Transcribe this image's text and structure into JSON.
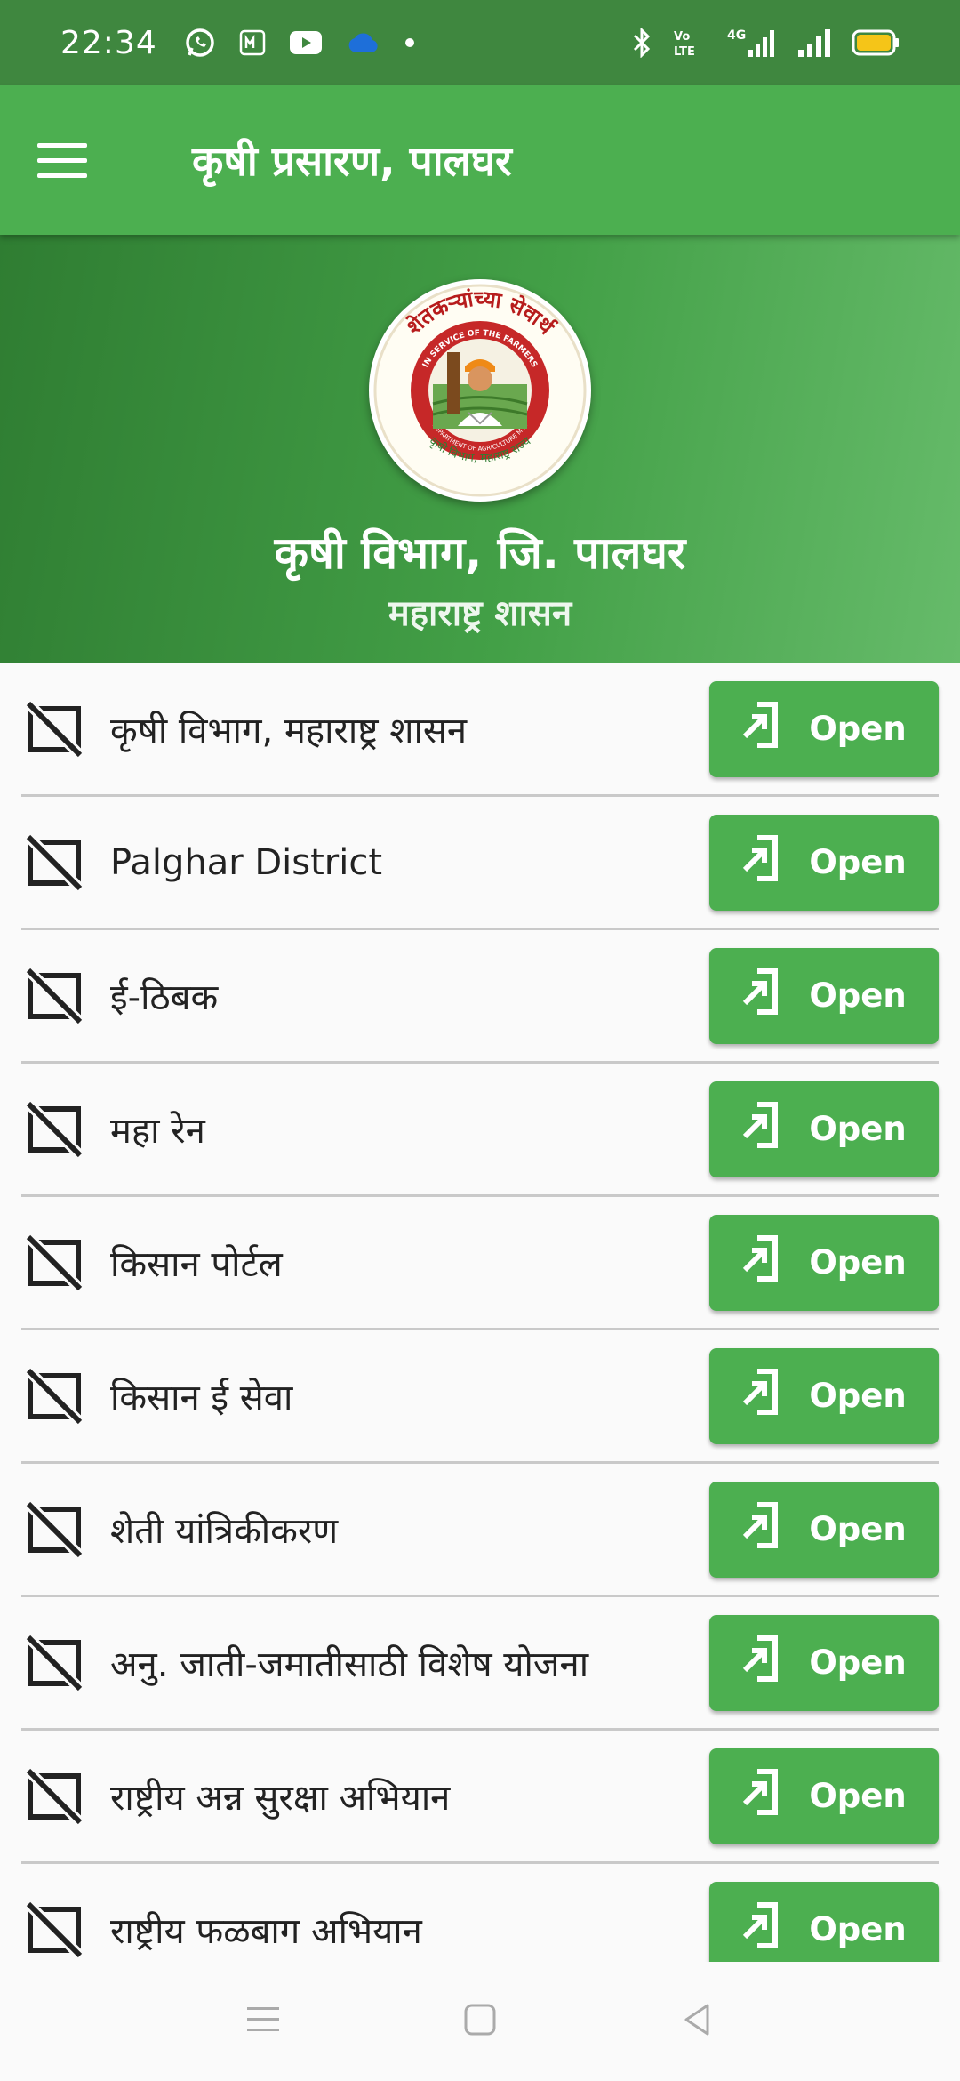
{
  "status_bar": {
    "time": "22:34",
    "left_icons": [
      "whatsapp-icon",
      "notification-m-icon",
      "youtube-icon",
      "cloud-icon",
      "dot-icon"
    ],
    "right_icons": [
      "bluetooth-icon",
      "volte-icon",
      "signal-4g-icon",
      "signal-icon",
      "battery-icon"
    ],
    "network_label": "4G",
    "volte_label": "Vo LTE"
  },
  "app_bar": {
    "title": "कृषी प्रसारण, पालघर",
    "menu_icon": "hamburger-menu-icon"
  },
  "header": {
    "title": "कृषी विभाग, जि. पालघर",
    "subtitle": "महाराष्ट्र शासन",
    "logo": "department-of-agriculture-seal",
    "logo_text_top": "शेतकऱ्यांच्या सेवार्थ",
    "logo_text_inner": "IN SERVICE OF THE FARMERS",
    "logo_text_dept": "DEPARTMENT OF AGRICULTURE M.S.",
    "logo_text_bottom": "कृषी विभाग, महाराष्ट्र राज्य"
  },
  "list": {
    "button_label": "Open",
    "items": [
      {
        "label": "कृषी विभाग, महाराष्ट्र शासन"
      },
      {
        "label": "Palghar District"
      },
      {
        "label": "ई-ठिबक"
      },
      {
        "label": "महा रेन"
      },
      {
        "label": "किसान पोर्टल"
      },
      {
        "label": "किसान ई सेवा"
      },
      {
        "label": "शेती यांत्रिकीकरण"
      },
      {
        "label": "अनु. जाती-जमातीसाठी विशेष योजना"
      },
      {
        "label": "राष्ट्रीय अन्न सुरक्षा अभियान"
      },
      {
        "label": "राष्ट्रीय फळबाग अभियान"
      }
    ]
  },
  "nav_bar": {
    "icons": [
      "recents-icon",
      "home-icon",
      "back-icon"
    ]
  },
  "colors": {
    "primary": "#4caf50",
    "primary_dark": "#3f873f",
    "background": "#fafafa"
  }
}
